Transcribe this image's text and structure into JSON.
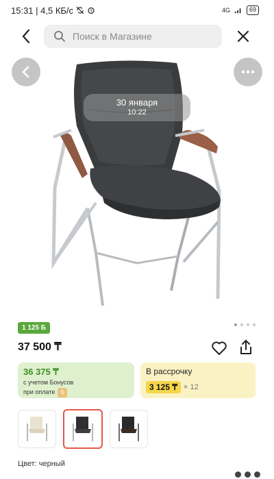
{
  "status_bar": {
    "time_speed": "15:31 | 4,5 КБ/с",
    "network": "4G",
    "battery": "69"
  },
  "header": {
    "search_placeholder": "Поиск в Магазине"
  },
  "gallery": {
    "date": "30 января",
    "time": "10:22",
    "dot_count": 4,
    "active_dot": 0
  },
  "product": {
    "bonus_badge": "1 125 Б",
    "price": "37 500 ₸"
  },
  "bonus_card": {
    "amount": "36 375 ₸",
    "note_line1": "с учетом Бонусов",
    "note_line2": "при оплате"
  },
  "installment_card": {
    "title": "В рассрочку",
    "amount": "3 125 ₸",
    "multiplier": "× 12"
  },
  "variants": [
    {
      "name": "beige",
      "seat_color": "#e9e2d0",
      "selected": false
    },
    {
      "name": "black",
      "seat_color": "#2f2f2f",
      "selected": true
    },
    {
      "name": "black-brown",
      "seat_color": "#3a2b25",
      "selected": false
    }
  ],
  "color_label": "Цвет: черный",
  "colors": {
    "accent_green": "#5aa83c",
    "selected_border": "#e6574b",
    "install_highlight": "#f6d64a"
  }
}
